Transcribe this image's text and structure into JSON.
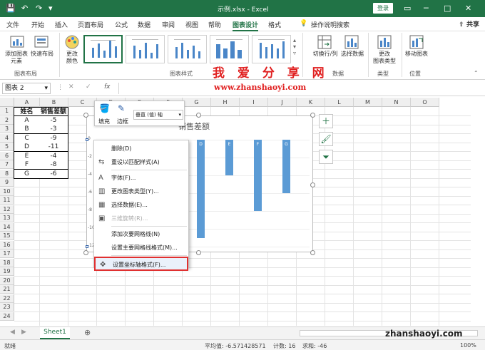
{
  "titlebar": {
    "title": "示例.xlsx - Excel",
    "login": "登录",
    "undo_icon": "undo-icon",
    "redo_icon": "redo-icon"
  },
  "tabs": [
    "文件",
    "开始",
    "插入",
    "页面布局",
    "公式",
    "数据",
    "审阅",
    "视图",
    "帮助",
    "图表设计",
    "格式"
  ],
  "tab_search": "操作说明搜索",
  "share": "共享",
  "ribbon": {
    "add_element": "添加图表\n元素",
    "quick_layout": "快速布局",
    "change_color": "更改\n颜色",
    "group_layout": "图表布局",
    "group_style": "图表样式",
    "switch_row_col": "切换行/列",
    "select_data": "选择数据",
    "group_data": "数据",
    "change_type": "更改\n图表类型",
    "group_type": "类型",
    "move_chart": "移动图表",
    "group_position": "位置"
  },
  "watermark": {
    "text": "我 爱 分 享 网",
    "url": "www.zhanshaoyi.com",
    "url2": "zhanshaoyi.com"
  },
  "formula_bar": {
    "name_box": "图表 2",
    "fx": "fx"
  },
  "columns": [
    "A",
    "B",
    "C",
    "D",
    "E",
    "F",
    "G",
    "H",
    "I",
    "J",
    "K",
    "L",
    "M",
    "N",
    "O"
  ],
  "rows": [
    "1",
    "2",
    "3",
    "4",
    "5",
    "6",
    "7",
    "8",
    "9",
    "10",
    "11",
    "12",
    "13",
    "14",
    "15",
    "16",
    "17",
    "18",
    "19",
    "20",
    "21",
    "22",
    "23",
    "24"
  ],
  "table": {
    "header": [
      "姓名",
      "销售差额"
    ],
    "rows": [
      [
        "A",
        "-5"
      ],
      [
        "B",
        "-3"
      ],
      [
        "C",
        "-9"
      ],
      [
        "D",
        "-11"
      ],
      [
        "E",
        "-4"
      ],
      [
        "F",
        "-8"
      ],
      [
        "G",
        "-6"
      ]
    ]
  },
  "chart": {
    "title_fragment": "销售差额",
    "y_ticks": [
      "0",
      "-2",
      "-4",
      "-6",
      "-8",
      "-10",
      "-12"
    ],
    "bar_labels": [
      "D",
      "E",
      "F",
      "G"
    ]
  },
  "chart_data": {
    "type": "bar",
    "categories": [
      "A",
      "B",
      "C",
      "D",
      "E",
      "F",
      "G"
    ],
    "values": [
      -5,
      -3,
      -9,
      -11,
      -4,
      -8,
      -6
    ],
    "title": "销售差额",
    "ylim": [
      -12,
      0
    ]
  },
  "minibar": {
    "fill": "填充",
    "border": "边框",
    "selector": "垂直 (值) 轴"
  },
  "context_menu": [
    {
      "label": "删除(D)",
      "icon": "delete-icon"
    },
    {
      "label": "重设以匹配样式(A)",
      "icon": "reset-icon"
    },
    {
      "label": "字体(F)...",
      "icon": "font-icon"
    },
    {
      "label": "更改图表类型(Y)...",
      "icon": "chart-type-icon"
    },
    {
      "label": "选择数据(E)...",
      "icon": "select-data-icon"
    },
    {
      "label": "三维旋转(R)...",
      "icon": "rotate-3d-icon",
      "disabled": true
    },
    {
      "label": "添加次要网格线(N)",
      "icon": ""
    },
    {
      "label": "设置主要网格线格式(M)...",
      "icon": ""
    },
    {
      "label": "设置坐标轴格式(F)...",
      "icon": "format-axis-icon",
      "highlighted": true
    }
  ],
  "sheet_tab": "Sheet1",
  "statusbar": {
    "ready": "就绪",
    "average": "平均值: -6.571428571",
    "count": "计数: 16",
    "sum": "求和: -46",
    "zoom": "100%"
  }
}
